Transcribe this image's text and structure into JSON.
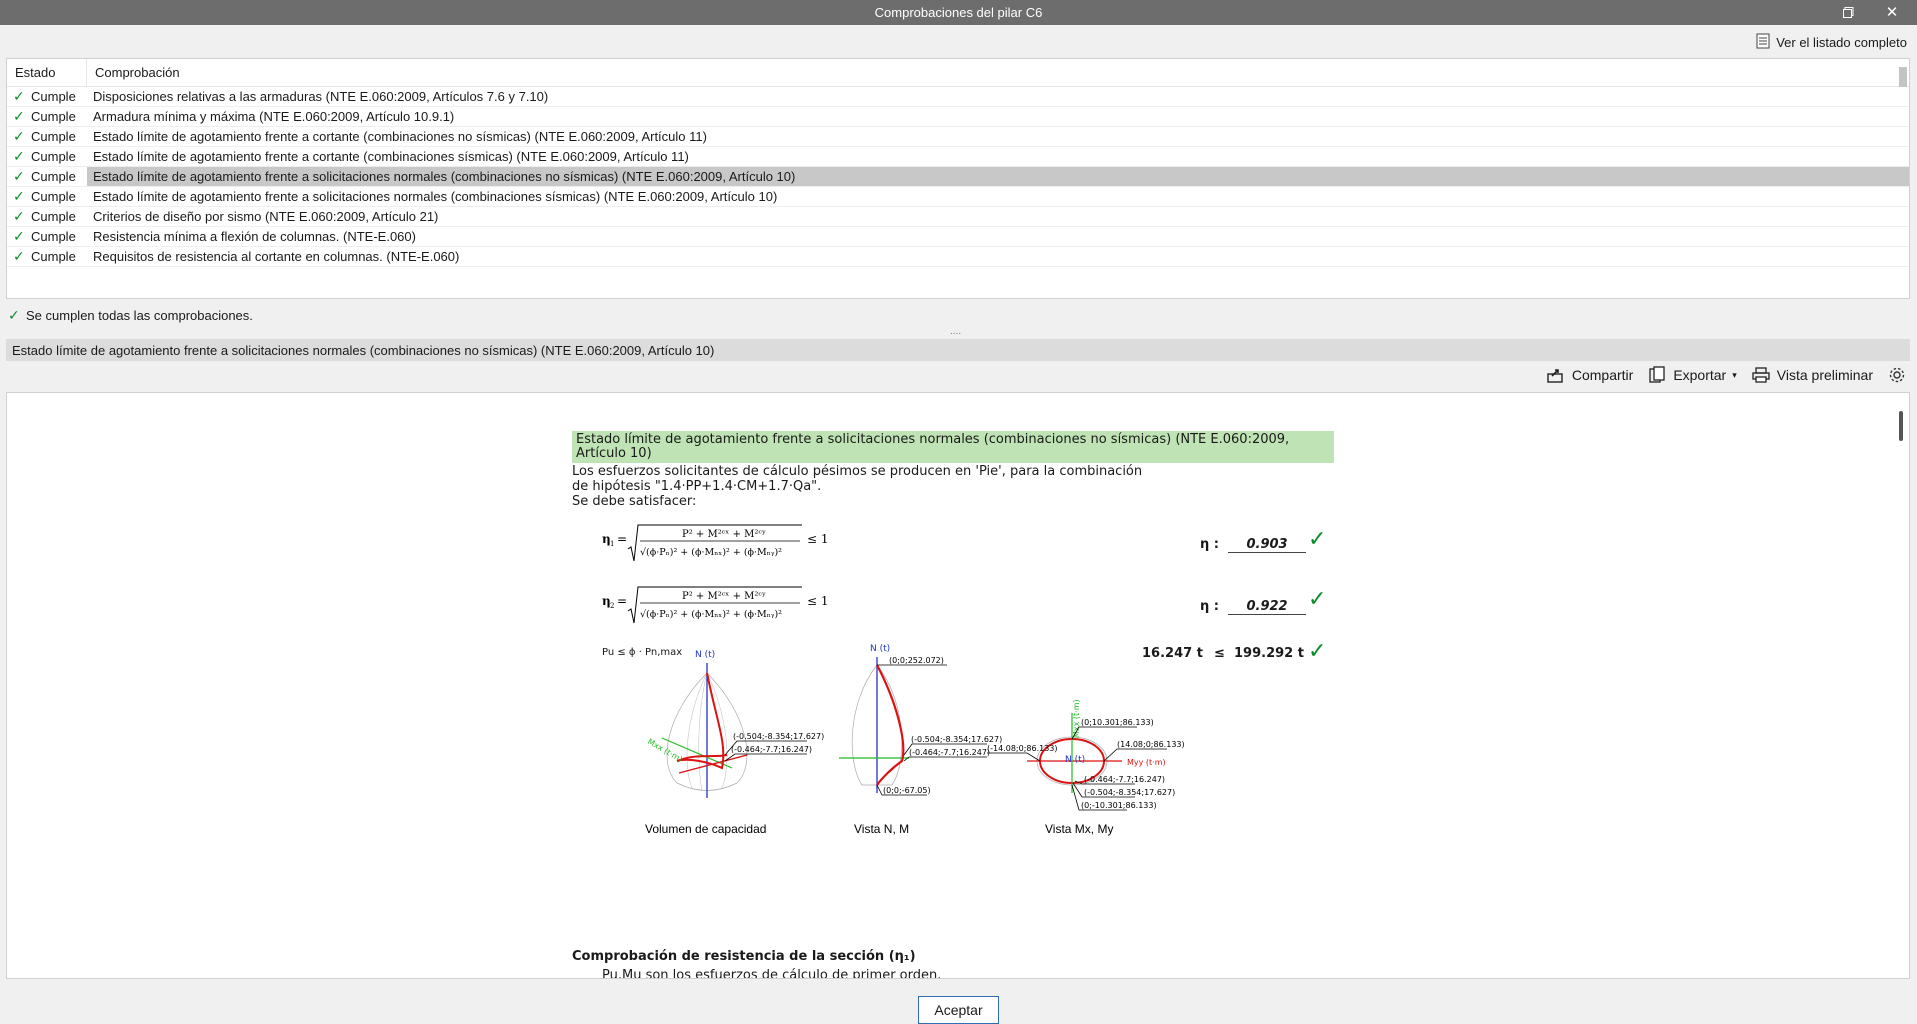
{
  "window": {
    "title": "Comprobaciones del pilar C6"
  },
  "topbar": {
    "full_listing_label": "Ver el listado completo"
  },
  "table": {
    "headers": {
      "estado": "Estado",
      "comprobacion": "Comprobación"
    },
    "rows": [
      {
        "status": "Cumple",
        "text": "Disposiciones relativas a las armaduras (NTE E.060:2009, Artículos 7.6 y 7.10)"
      },
      {
        "status": "Cumple",
        "text": "Armadura mínima y máxima (NTE E.060:2009, Artículo 10.9.1)"
      },
      {
        "status": "Cumple",
        "text": "Estado límite de agotamiento frente a cortante (combinaciones no sísmicas) (NTE E.060:2009, Artículo 11)"
      },
      {
        "status": "Cumple",
        "text": "Estado límite de agotamiento frente a cortante (combinaciones sísmicas) (NTE E.060:2009, Artículo 11)"
      },
      {
        "status": "Cumple",
        "text": "Estado límite de agotamiento frente a solicitaciones normales (combinaciones no sísmicas) (NTE E.060:2009, Artículo 10)",
        "selected": true
      },
      {
        "status": "Cumple",
        "text": "Estado límite de agotamiento frente a solicitaciones normales (combinaciones sísmicas) (NTE E.060:2009, Artículo 10)"
      },
      {
        "status": "Cumple",
        "text": "Criterios de diseño por sismo (NTE E.060:2009, Artículo 21)"
      },
      {
        "status": "Cumple",
        "text": "Resistencia mínima a flexión de columnas. (NTE-E.060)"
      },
      {
        "status": "Cumple",
        "text": "Requisitos de resistencia al cortante en columnas. (NTE-E.060)"
      }
    ]
  },
  "summary": {
    "text": "Se cumplen todas las comprobaciones."
  },
  "splitter": "....",
  "section": {
    "title": "Estado límite de agotamiento frente a solicitaciones normales (combinaciones no sísmicas) (NTE E.060:2009, Artículo 10)"
  },
  "toolbar": {
    "share": "Compartir",
    "export": "Exportar",
    "preview": "Vista preliminar"
  },
  "report": {
    "title": "Estado límite de agotamiento frente a solicitaciones normales (combinaciones no sísmicas) (NTE E.060:2009, Artículo 10)",
    "intro_1": "Los esfuerzos solicitantes de cálculo pésimos se producen en 'Pie', para la combinación",
    "intro_2": "de hipótesis \"1.4·PP+1.4·CM+1.7·Qa\".",
    "intro_3": "Se debe satisfacer:",
    "eta1_label": "η",
    "eta1_value": "0.903",
    "eta2_label": "η",
    "eta2_value": "0.922",
    "pu_left": "Pu ≤ ϕ · Pn,max",
    "pu_value": "16.247 t",
    "pu_leq": "≤",
    "pn_value": "199.292 t",
    "fig1_caption": "Volumen de capacidad",
    "fig2_caption": "Vista N, M",
    "fig3_caption": "Vista Mx, My",
    "fig_labels": {
      "n_axis": "N (t)",
      "mxx": "Mxx (t·m)",
      "myy": "Myy (t·m)",
      "mx_axis": "Mxx (t·m)",
      "p1": "(-0.504;-8.354;17.627)",
      "p2": "(-0.464;-7.7;16.247)",
      "top": "(0;0;252.072)",
      "bottom": "(0;0;-67.05)",
      "left_mm": "(-14.08;0;86.133)",
      "right_mm": "(14.08;0;86.133)",
      "top_mm": "(0;10.301;86.133)",
      "bot_mm": "(0;-10.301;86.133)"
    },
    "section_heading": "Comprobación de resistencia de la sección (η₁)",
    "section_line": "Pu,Mu son los esfuerzos de cálculo de primer orden."
  },
  "footer": {
    "ok_label": "Aceptar"
  }
}
